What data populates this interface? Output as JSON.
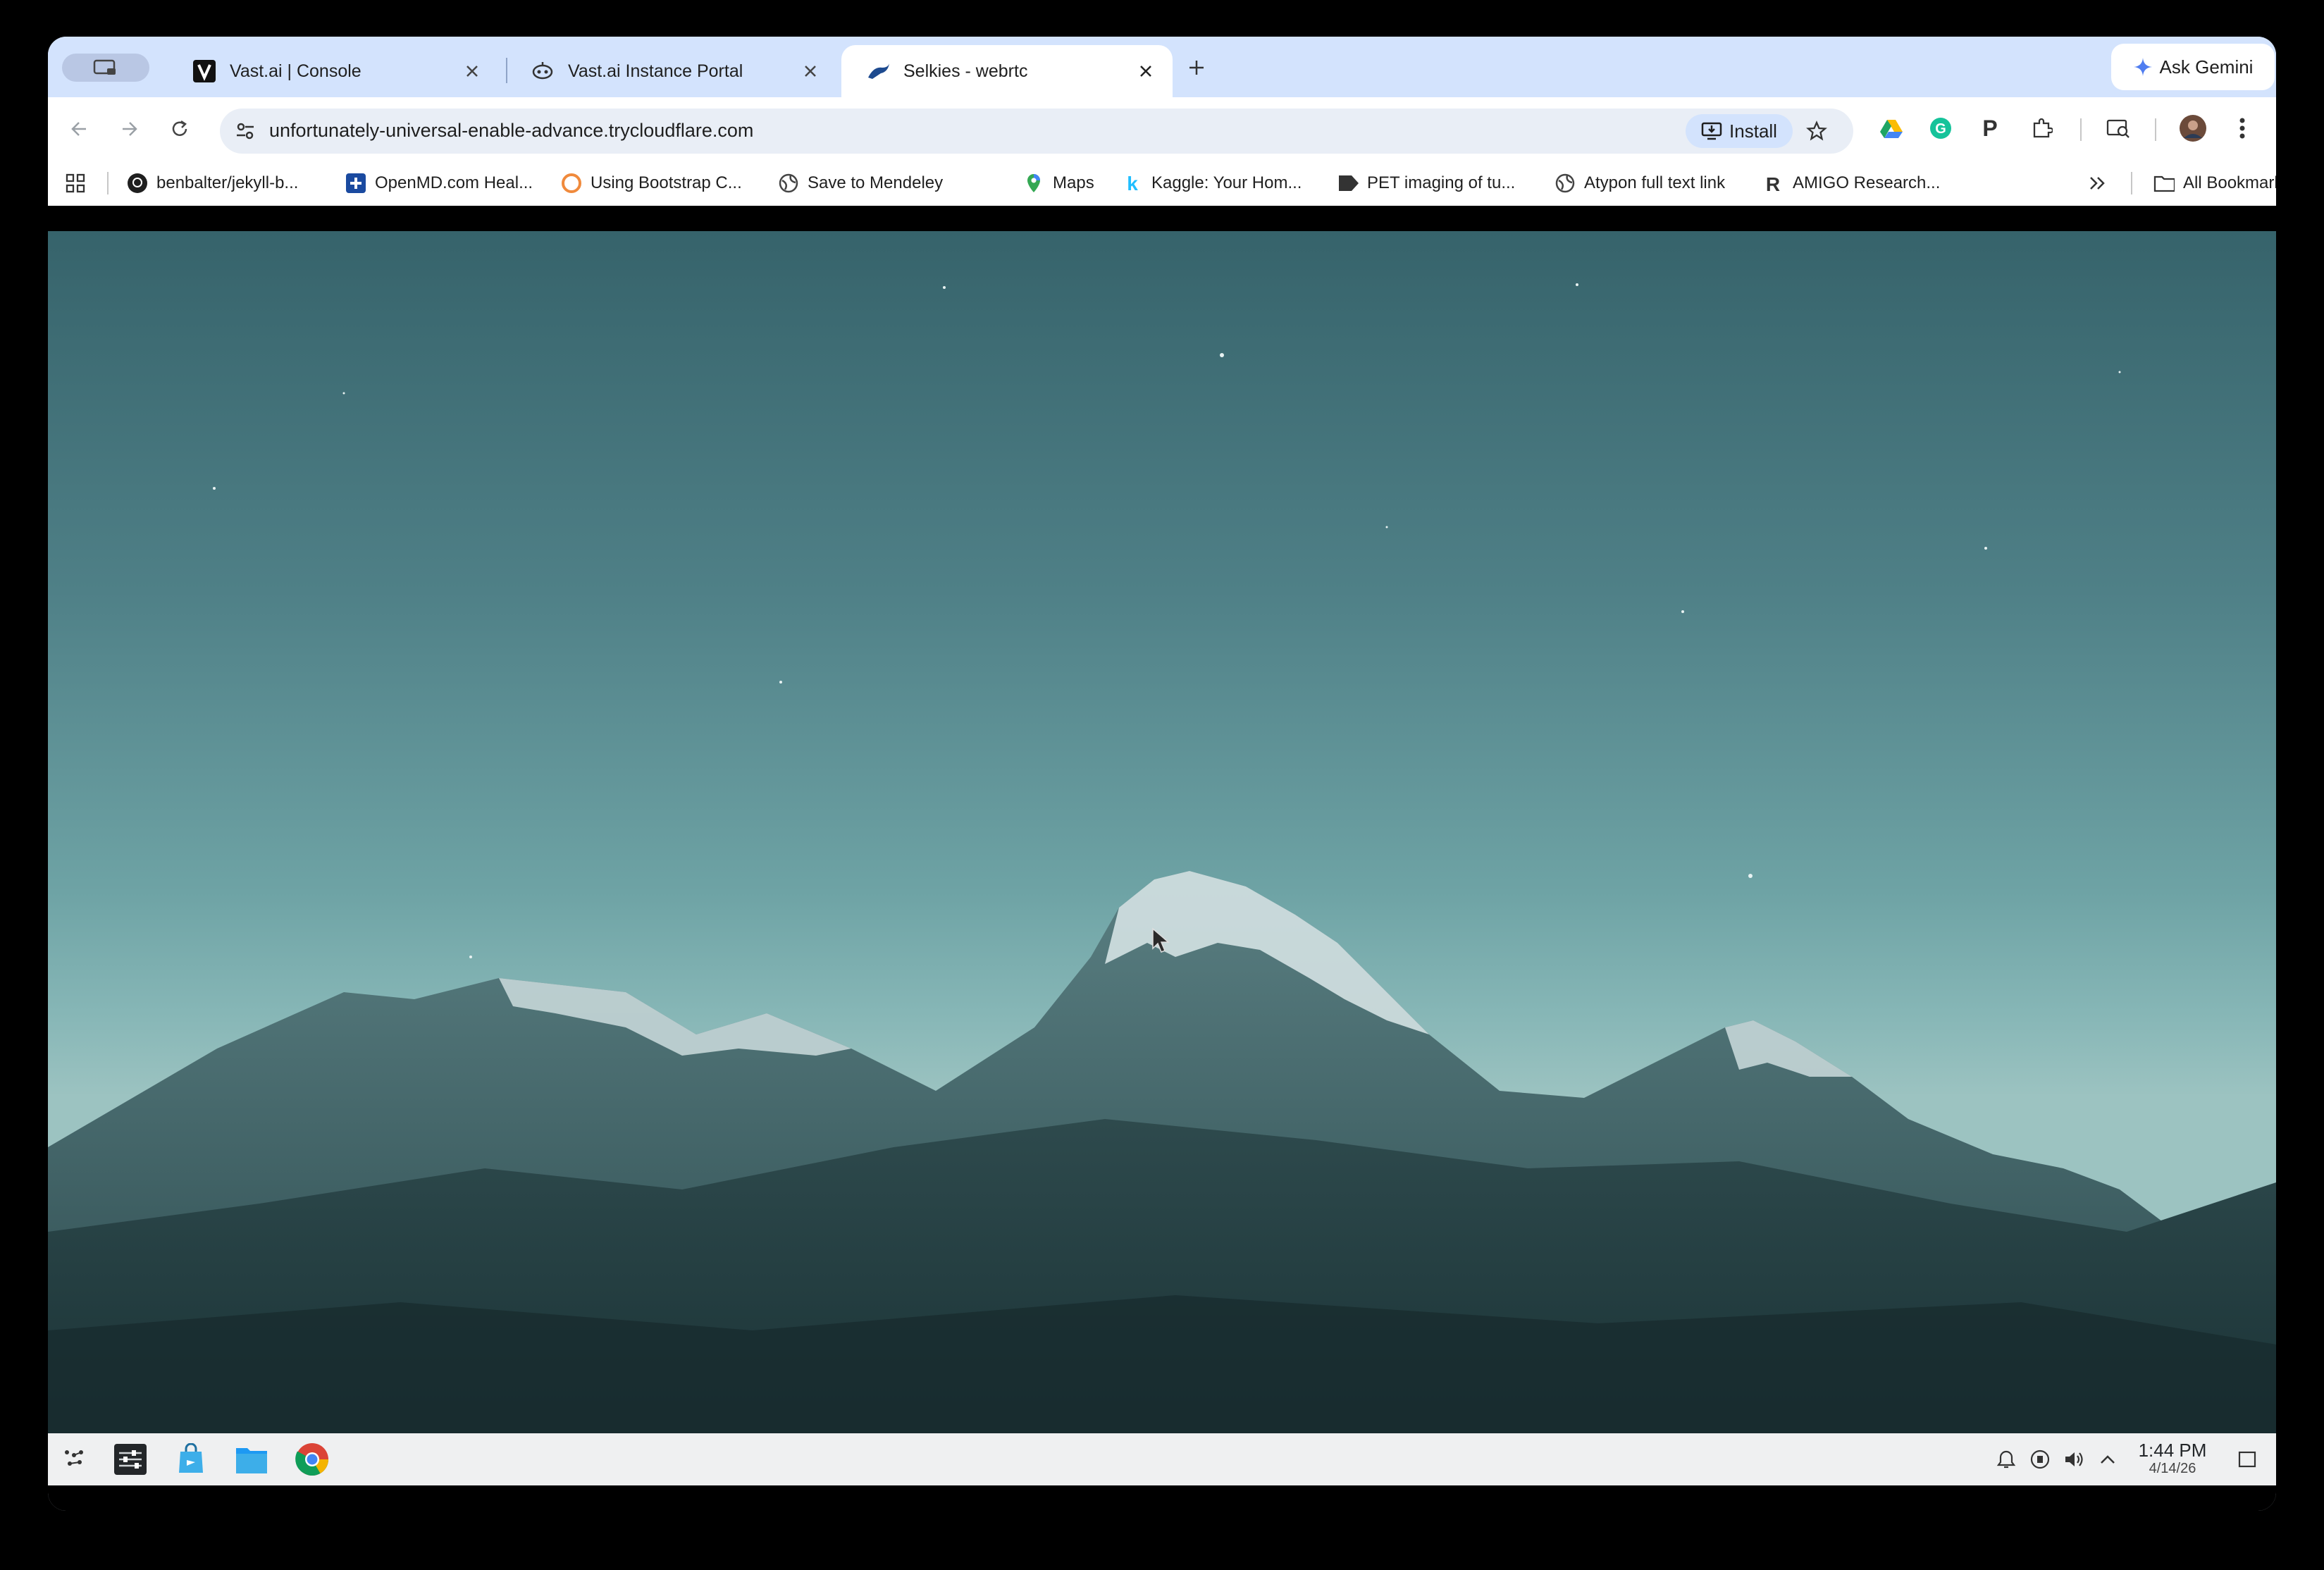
{
  "browser": {
    "tabs": [
      {
        "title": "Vast.ai | Console",
        "active": false
      },
      {
        "title": "Vast.ai Instance Portal",
        "active": false
      },
      {
        "title": "Selkies - webrtc",
        "active": true
      }
    ],
    "ask_gemini": "Ask Gemini",
    "url": "unfortunately-universal-enable-advance.trycloudflare.com",
    "install_label": "Install"
  },
  "bookmarks": {
    "items": [
      {
        "label": "benbalter/jekyll-b...",
        "icon": "github-icon"
      },
      {
        "label": "OpenMD.com Heal...",
        "icon": "openmd-icon"
      },
      {
        "label": "Using Bootstrap C...",
        "icon": "bootstrap-circle-icon"
      },
      {
        "label": "Save to Mendeley",
        "icon": "globe-icon"
      },
      {
        "label": "Maps",
        "icon": "maps-pin-icon"
      },
      {
        "label": "Kaggle: Your Hom...",
        "icon": "kaggle-icon"
      },
      {
        "label": "PET imaging of tu...",
        "icon": "pet-tag-icon"
      },
      {
        "label": "Atypon full text link",
        "icon": "globe-icon"
      },
      {
        "label": "AMIGO Research...",
        "icon": "amigo-r-icon"
      }
    ],
    "all_bookmarks": "All Bookmarks"
  },
  "desktop": {
    "taskbar": {
      "apps": [
        "app-launcher-icon",
        "system-settings-icon",
        "discover-store-icon",
        "file-manager-icon",
        "chrome-icon"
      ],
      "tray": [
        "notifications-icon",
        "network-icon",
        "volume-icon",
        "expand-tray-icon"
      ],
      "time": "1:44 PM",
      "date": "4/14/26"
    }
  },
  "colors": {
    "tabstrip": "#d3e3fd",
    "sky_top": "#36636b",
    "sky_horizon": "#9cc3c1",
    "mountain_dark": "#1f3a3d"
  }
}
